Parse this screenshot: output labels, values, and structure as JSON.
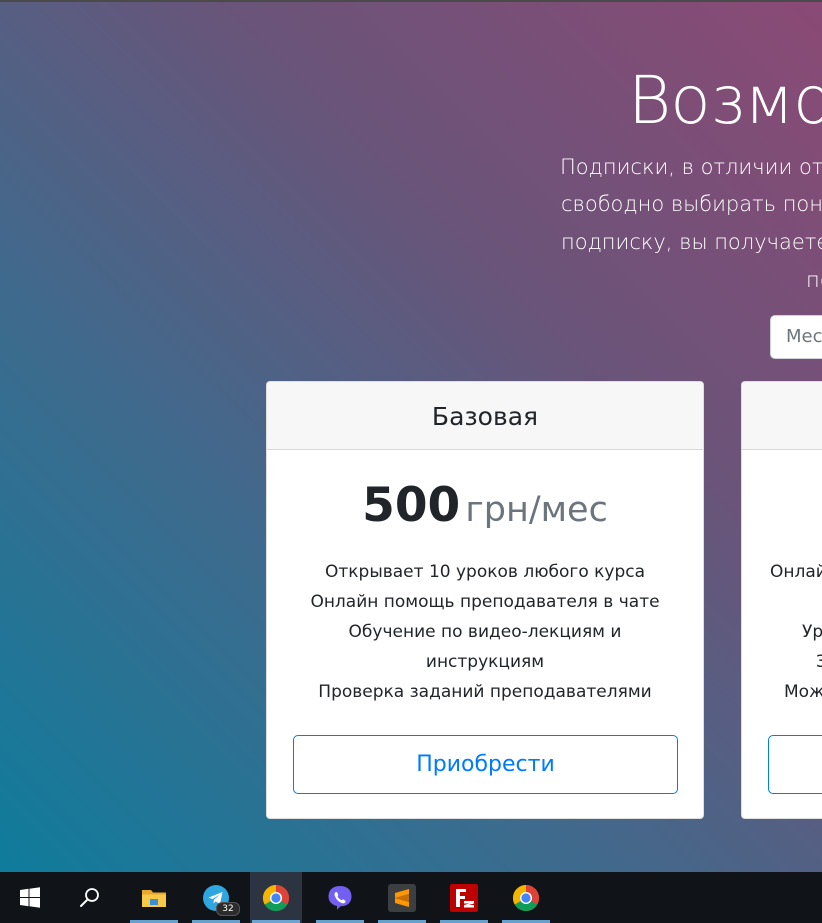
{
  "hero": {
    "title": "Возмож",
    "description_lines": [
      "Подписки, в отличии от",
      "свободно выбирать пон",
      "подписку, вы получаете",
      "по"
    ],
    "period_select": {
      "selected": "Мес"
    }
  },
  "cards": [
    {
      "name": "Базовая",
      "price_amount": "500",
      "price_unit": "грн/мес",
      "features": [
        "Открывает 10 уроков любого курса",
        "Онлайн помощь преподавателя в чате",
        "Обучение по видео-лекциям и",
        "инструкциям",
        "Проверка заданий преподавателями"
      ],
      "button_label": "Приобрести"
    },
    {
      "partial_features": [
        "Онлай",
        "Ур",
        "З",
        "Мож"
      ]
    }
  ],
  "taskbar": {
    "items": [
      {
        "name": "start-button",
        "icon": "windows-logo-icon"
      },
      {
        "name": "search-button",
        "icon": "search-icon"
      },
      {
        "name": "file-explorer",
        "icon": "folder-icon",
        "open": true
      },
      {
        "name": "telegram",
        "icon": "telegram-icon",
        "open": true,
        "badge": "32"
      },
      {
        "name": "chrome",
        "icon": "chrome-icon",
        "open": true,
        "active": true
      },
      {
        "name": "viber",
        "icon": "viber-icon",
        "open": true
      },
      {
        "name": "sublime-text",
        "icon": "sublime-text-icon",
        "open": true
      },
      {
        "name": "filezilla",
        "icon": "filezilla-icon",
        "open": true
      },
      {
        "name": "chrome-2",
        "icon": "chrome-icon",
        "open": true
      }
    ]
  },
  "colors": {
    "accent": "#007bff",
    "gradient_top_right": "#8a4a75",
    "gradient_bottom_left": "#0f7c9c",
    "taskbar": "#101418"
  }
}
